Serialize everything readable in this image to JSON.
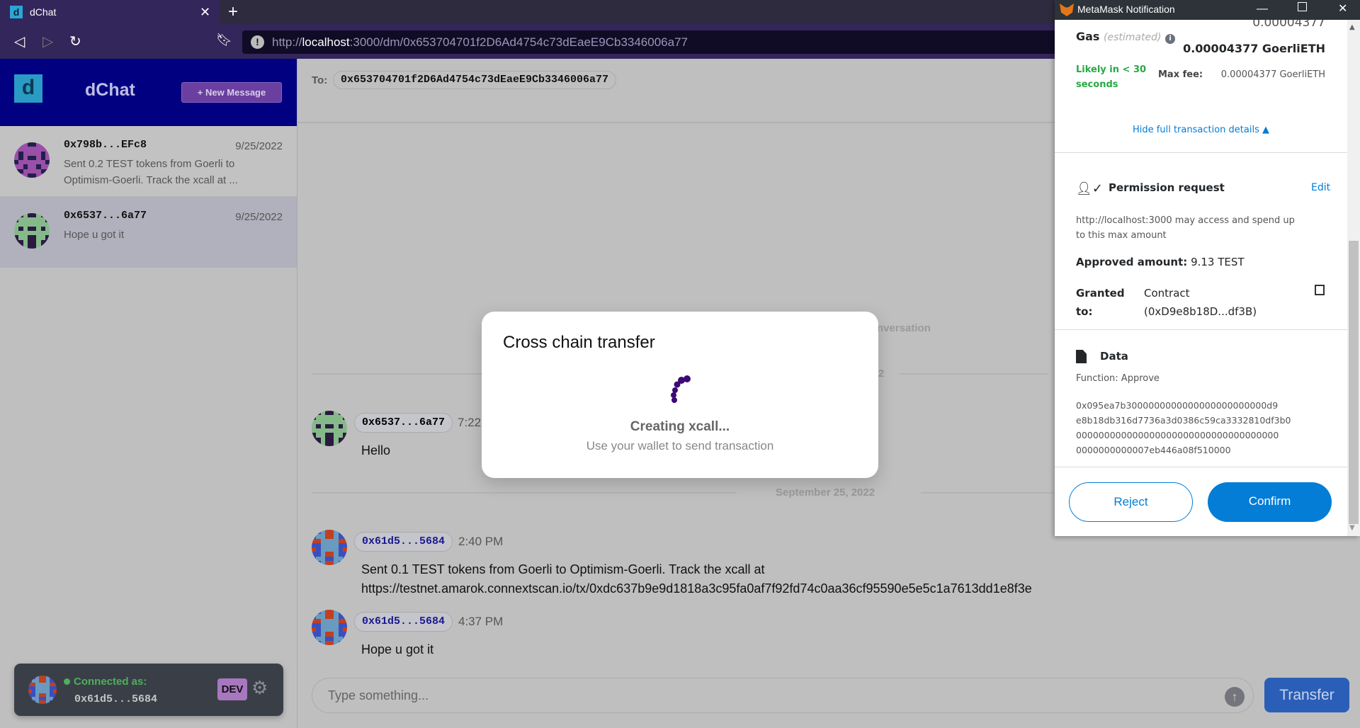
{
  "browser": {
    "tab_title": "dChat",
    "url_prefix": "http://",
    "url_host": "localhost",
    "url_rest": ":3000/dm/0x653704701f2D6Ad4754c73dEaeE9Cb3346006a77"
  },
  "sidebar": {
    "logo_letter": "d",
    "app_title": "dChat",
    "new_message_label": "+ New Message",
    "conversations": [
      {
        "name": "0x798b...EFc8",
        "date": "9/25/2022",
        "preview": "Sent 0.2 TEST tokens from Goerli to Optimism-Goerli. Track the xcall at ..."
      },
      {
        "name": "0x6537...6a77",
        "date": "9/25/2022",
        "preview": "Hope u got it"
      }
    ],
    "connected_label": "Connected as:",
    "connected_address": "0x61d5...5684",
    "env_badge": "DEV"
  },
  "chat": {
    "to_label": "To:",
    "to_address": "0x653704701f2D6Ad4754c73dEaeE9Cb3346006a77",
    "partial_header": "nversation",
    "partial_date": "2",
    "date_separator": "September 25, 2022",
    "messages": [
      {
        "sender": "0x6537...6a77",
        "time": "7:22",
        "text": "Hello"
      },
      {
        "sender": "0x61d5...5684",
        "time": "2:40 PM",
        "text": "Sent 0.1 TEST tokens from Goerli to Optimism-Goerli. Track the xcall at",
        "text2": "https://testnet.amarok.connextscan.io/tx/0xdc637b9e9d1818a3c95fa0af7f92fd74c0aa36cf95590e5e5c1a7613dd1e8f3e"
      },
      {
        "sender": "0x61d5...5684",
        "time": "4:37 PM",
        "text": "Hope u got it"
      }
    ],
    "input_placeholder": "Type something...",
    "transfer_label": "Transfer"
  },
  "modal": {
    "title": "Cross chain transfer",
    "status": "Creating xcall...",
    "subtitle": "Use your wallet to send transaction"
  },
  "metamask": {
    "window_title": "MetaMask Notification",
    "gas_label": "Gas",
    "gas_estimated": "(estimated)",
    "gas_top": "0.00004377",
    "gas_total": "0.00004377 GoerliETH",
    "likely_1": "Likely in < 30",
    "likely_2": "seconds",
    "max_fee_label": "Max fee:",
    "max_fee_value": "0.00004377 GoerliETH",
    "hide_details": "Hide full transaction details",
    "permission_title": "Permission request",
    "edit_label": "Edit",
    "permission_desc_1": "http://localhost:3000 may access and spend up",
    "permission_desc_2": "to this max amount",
    "approved_label": "Approved amount:",
    "approved_value": "9.13 TEST",
    "granted_label_1": "Granted",
    "granted_label_2": "to:",
    "granted_value_1": "Contract",
    "granted_value_2": "(0xD9e8b18D...df3B)",
    "data_title": "Data",
    "function_label": "Function: Approve",
    "hex": [
      "0x095ea7b3000000000000000000000000d9",
      "e8b18db316d7736a3d0386c59ca3332810df3b0",
      "000000000000000000000000000000000000",
      "0000000000007eb446a08f510000"
    ],
    "reject_label": "Reject",
    "confirm_label": "Confirm"
  },
  "colors": {
    "sidebar_header": "#000080",
    "new_message": "#6a3fa0",
    "transfer": "#2b5eb7",
    "metamask_blue": "#037dd6",
    "metamask_green": "#28a745",
    "spinner": "#3b0a75"
  }
}
